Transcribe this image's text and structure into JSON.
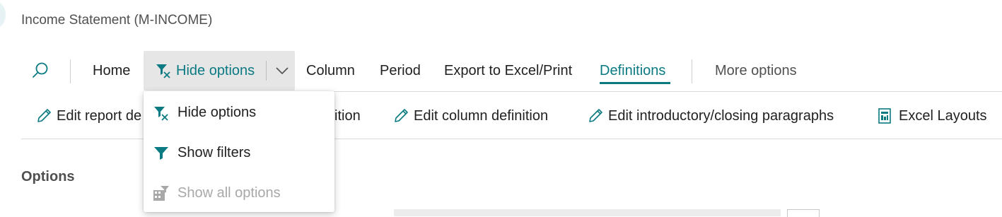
{
  "page": {
    "title": "Income Statement (M-INCOME)"
  },
  "colors": {
    "accent": "#0b7a82",
    "disabled": "#a8a8a8"
  },
  "actionbar": {
    "search_icon": "search-icon",
    "home": "Home",
    "hide_options": "Hide options",
    "column": "Column",
    "period": "Period",
    "export": "Export to Excel/Print",
    "definitions": "Definitions",
    "more_options": "More options",
    "active_tab": "Definitions"
  },
  "toolbar": {
    "edit_report_def": "Edit report de",
    "edit_row_def_tail": "ition",
    "edit_column_def": "Edit column definition",
    "edit_paragraphs": "Edit introductory/closing paragraphs",
    "excel_layouts": "Excel Layouts"
  },
  "dropdown": {
    "items": [
      {
        "label": "Hide options",
        "icon": "hide-filter-icon",
        "enabled": true
      },
      {
        "label": "Show filters",
        "icon": "filter-icon",
        "enabled": true
      },
      {
        "label": "Show all options",
        "icon": "show-all-options-icon",
        "enabled": false
      }
    ]
  },
  "section": {
    "options": "Options"
  }
}
